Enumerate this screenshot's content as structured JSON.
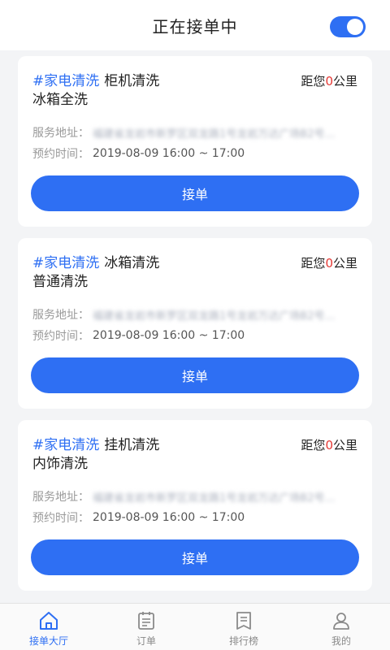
{
  "header": {
    "title": "正在接单中",
    "toggle_on": true
  },
  "orders": [
    {
      "tag": "#家电清洗",
      "title_line1": "柜机清洗",
      "title_line2": "冰箱全洗",
      "distance_prefix": "距您",
      "distance_value": "0",
      "distance_unit": "公里",
      "address_label": "服务地址：",
      "address_value": "福建省龙岩市新罗区双龙路1号龙岩万达广场B2号…",
      "time_label": "预约时间：",
      "time_value": "2019-08-09 16:00 ~ 17:00",
      "button_label": "接单"
    },
    {
      "tag": "#家电清洗",
      "title_line1": "冰箱清洗",
      "title_line2": "普通清洗",
      "distance_prefix": "距您",
      "distance_value": "0",
      "distance_unit": "公里",
      "address_label": "服务地址：",
      "address_value": "福建省龙岩市新罗区双龙路1号龙岩万达广场B2号…",
      "time_label": "预约时间：",
      "time_value": "2019-08-09 16:00 ~ 17:00",
      "button_label": "接单"
    },
    {
      "tag": "#家电清洗",
      "title_line1": "挂机清洗",
      "title_line2": "内饰清洗",
      "distance_prefix": "距您",
      "distance_value": "0",
      "distance_unit": "公里",
      "address_label": "服务地址：",
      "address_value": "福建省龙岩市新罗区双龙路1号龙岩万达广场B2号…",
      "time_label": "预约时间：",
      "time_value": "2019-08-09 16:00 ~ 17:00",
      "button_label": "接单"
    }
  ],
  "tabbar": {
    "items": [
      {
        "label": "接单大厅",
        "icon": "home-icon",
        "active": true
      },
      {
        "label": "订单",
        "icon": "order-list-icon",
        "active": false
      },
      {
        "label": "排行榜",
        "icon": "ranking-icon",
        "active": false
      },
      {
        "label": "我的",
        "icon": "profile-icon",
        "active": false
      }
    ]
  },
  "colors": {
    "accent": "#2e6ff3",
    "distance_number": "#e53935",
    "background": "#f3f4f6"
  }
}
